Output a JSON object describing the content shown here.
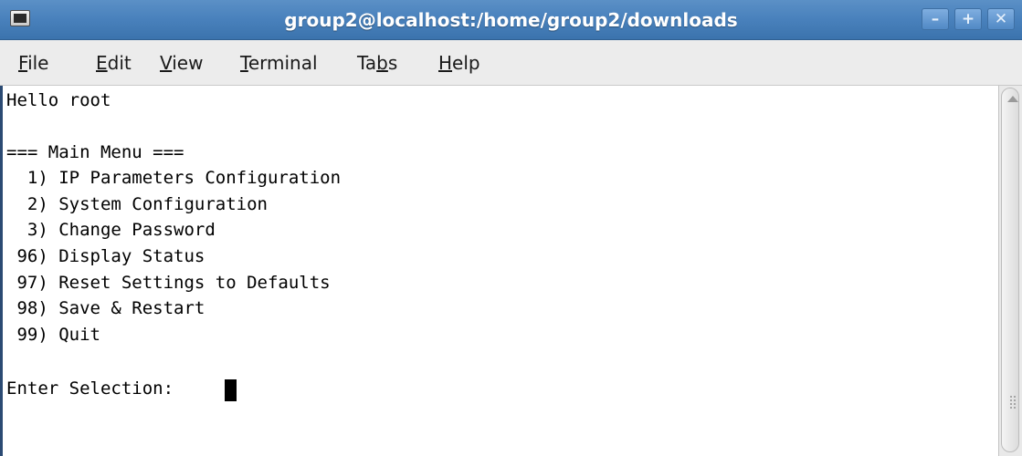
{
  "window": {
    "title": "group2@localhost:/home/group2/downloads",
    "buttons": {
      "minimize": "–",
      "maximize": "+",
      "close": "✕"
    }
  },
  "menubar": {
    "items": [
      {
        "label": "File",
        "mnemonic": "F"
      },
      {
        "label": "Edit",
        "mnemonic": "E"
      },
      {
        "label": "View",
        "mnemonic": "V"
      },
      {
        "label": "Terminal",
        "mnemonic": "T"
      },
      {
        "label": "Tabs",
        "mnemonic": "b"
      },
      {
        "label": "Help",
        "mnemonic": "H"
      }
    ]
  },
  "terminal": {
    "greeting": "Hello root",
    "menu_header": "=== Main Menu ===",
    "options": [
      "  1) IP Parameters Configuration",
      "  2) System Configuration",
      "  3) Change Password",
      " 96) Display Status",
      " 97) Reset Settings to Defaults",
      " 98) Save & Restart",
      " 99) Quit"
    ],
    "prompt": "Enter Selection: "
  },
  "colors": {
    "titlebar": "#4a82bd",
    "title_text": "#ffffff",
    "menubar_bg": "#ececec",
    "terminal_bg": "#ffffff",
    "terminal_fg": "#000000"
  }
}
